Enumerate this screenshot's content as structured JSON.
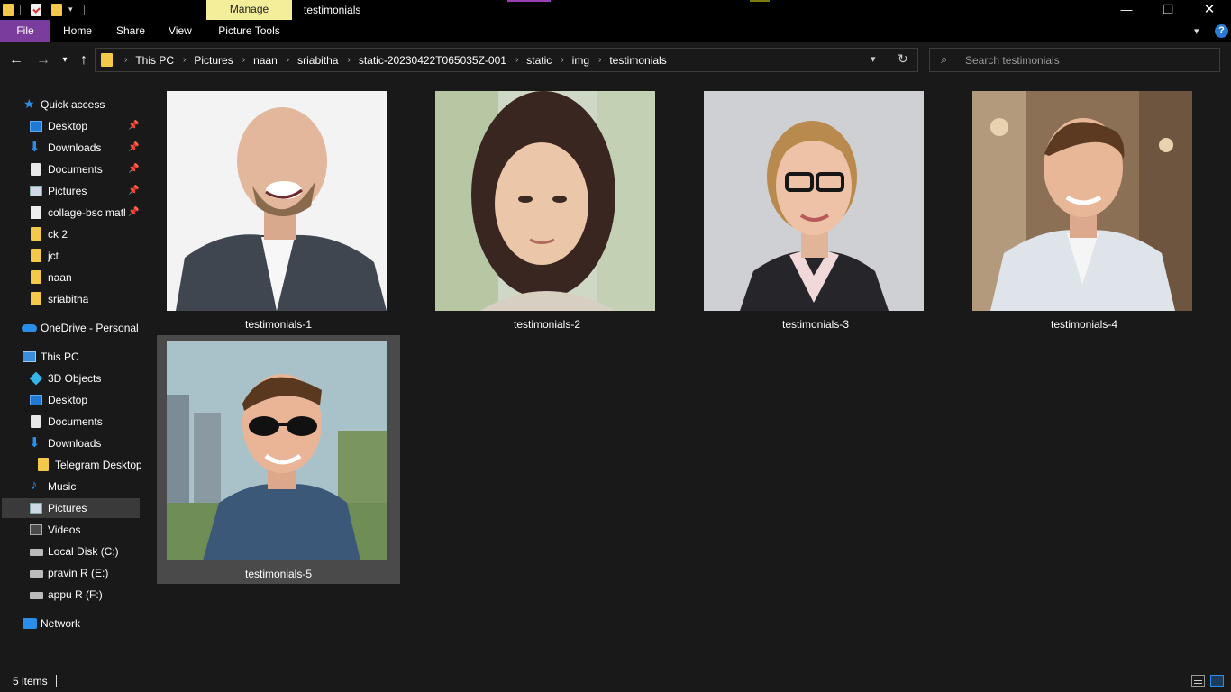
{
  "titlebar": {
    "manage_label": "Manage",
    "window_title": "testimonials",
    "minimize_glyph": "—",
    "maximize_glyph": "❐",
    "close_glyph": "✕"
  },
  "ribbon": {
    "file_label": "File",
    "tabs": [
      {
        "label": "Home"
      },
      {
        "label": "Share"
      },
      {
        "label": "View"
      },
      {
        "label": "Picture Tools"
      }
    ],
    "help_label": "?"
  },
  "address": {
    "crumbs": [
      "This PC",
      "Pictures",
      "naan",
      "sriabitha",
      "static-20230422T065035Z-001",
      "static",
      "img",
      "testimonials"
    ],
    "search_placeholder": "Search testimonials"
  },
  "navpane": {
    "quick_access": {
      "label": "Quick access",
      "items": [
        {
          "label": "Desktop",
          "icon": "desktop-icon",
          "pinned": true
        },
        {
          "label": "Downloads",
          "icon": "download-icon",
          "pinned": true
        },
        {
          "label": "Documents",
          "icon": "documents-icon",
          "pinned": true
        },
        {
          "label": "Pictures",
          "icon": "pictures-icon",
          "pinned": true
        },
        {
          "label": "collage-bsc matl",
          "icon": "file-icon",
          "pinned": true
        },
        {
          "label": "ck 2",
          "icon": "folder-icon",
          "pinned": false
        },
        {
          "label": "jct",
          "icon": "folder-icon",
          "pinned": false
        },
        {
          "label": "naan",
          "icon": "folder-icon",
          "pinned": false
        },
        {
          "label": "sriabitha",
          "icon": "folder-icon",
          "pinned": false
        }
      ]
    },
    "onedrive": {
      "label": "OneDrive - Personal"
    },
    "this_pc": {
      "label": "This PC",
      "items": [
        {
          "label": "3D Objects"
        },
        {
          "label": "Desktop"
        },
        {
          "label": "Documents"
        },
        {
          "label": "Downloads"
        },
        {
          "label": "Telegram Desktop"
        },
        {
          "label": "Music"
        },
        {
          "label": "Pictures"
        },
        {
          "label": "Videos"
        },
        {
          "label": "Local Disk (C:)"
        },
        {
          "label": "pravin R  (E:)"
        },
        {
          "label": "appu R  (F:)"
        }
      ]
    },
    "network": {
      "label": "Network"
    },
    "selected_item": "Pictures"
  },
  "files": [
    {
      "name": "testimonials-1",
      "selected": false
    },
    {
      "name": "testimonials-2",
      "selected": false
    },
    {
      "name": "testimonials-3",
      "selected": false
    },
    {
      "name": "testimonials-4",
      "selected": false
    },
    {
      "name": "testimonials-5",
      "selected": true
    }
  ],
  "status": {
    "item_count": "5 items"
  },
  "colors": {
    "background": "#191919",
    "file_tab": "#7a3d9e",
    "manage_tab": "#f4ee9a",
    "folder": "#f4c84a",
    "accent": "#2a8ee8",
    "selection": "#4a4a4a"
  }
}
